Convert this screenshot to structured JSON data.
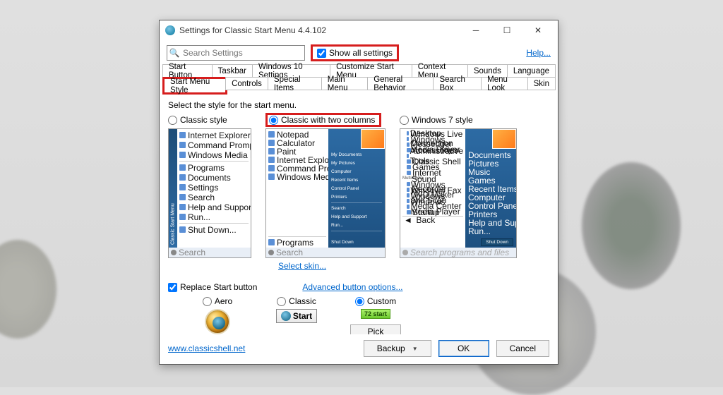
{
  "window": {
    "title": "Settings for Classic Start Menu 4.4.102"
  },
  "toolbar": {
    "search_placeholder": "Search Settings",
    "show_all_label": "Show all settings",
    "show_all_checked": true,
    "help_label": "Help..."
  },
  "tabs_row1": [
    "Start Button",
    "Taskbar",
    "Windows 10 Settings",
    "Customize Start Menu",
    "Context Menu",
    "Sounds",
    "Language"
  ],
  "tabs_row2_active": "Start Menu Style",
  "tabs_row2_rest": [
    "Controls",
    "Special Items",
    "Main Menu",
    "General Behavior",
    "Search Box",
    "Menu Look",
    "Skin"
  ],
  "content": {
    "description": "Select the style for the start menu.",
    "styles": {
      "classic": "Classic style",
      "twocol": "Classic with two columns",
      "win7": "Windows 7 style",
      "selected": "twocol"
    },
    "classic_side_label": "Classic Start Menu",
    "classic_items": [
      "Internet Explorer",
      "Command Prompt",
      "Windows Media Player"
    ],
    "classic_items2": [
      "Programs",
      "Documents",
      "Settings",
      "Search",
      "Help and Support",
      "Run..."
    ],
    "classic_items3": [
      "Shut Down..."
    ],
    "classic_search": "Search",
    "twocol_left": [
      "Notepad",
      "Calculator",
      "Paint",
      "Internet Explorer",
      "Command Prompt",
      "Windows Media Player"
    ],
    "twocol_left_bottom": "Programs",
    "twocol_right": [
      "My Documents",
      "My Pictures",
      "Computer",
      "Recent Items",
      "Control Panel",
      "Printers"
    ],
    "twocol_right2": [
      "Search",
      "Help and Support",
      "Run..."
    ],
    "twocol_right_shut": "Shut Down",
    "win7_left_header": "Remote Desktop Connection",
    "win7_left_items1": [
      "Windows Live Messenger",
      "Windows Media Player",
      "Accessories",
      "Administrative Tools",
      "Classic Shell",
      "Games",
      "Internet"
    ],
    "win7_left_group": "Multimedia",
    "win7_left_items2": [
      "Sound Recorder",
      "Windows DVD Maker",
      "Windows Fax and Scan",
      "Windows Media Center",
      "Windows Media Player",
      "Startup"
    ],
    "win7_left_back": "Back",
    "win7_search_hint": "Search programs and files",
    "win7_right": [
      "Documents",
      "Pictures",
      "Music",
      "Games",
      "Recent Items",
      "Computer",
      "Control Panel",
      "Printers",
      "Help and Support",
      "Run..."
    ],
    "win7_shut": "Shut Down",
    "select_skin": "Select skin...",
    "replace_label": "Replace Start button",
    "replace_checked": true,
    "advanced_link": "Advanced button options...",
    "button_styles": {
      "aero": "Aero",
      "classic": "Classic",
      "classic_btn_text": "Start",
      "custom": "Custom",
      "custom_preview": "72 start",
      "selected": "custom",
      "pick_label": "Pick image..."
    }
  },
  "footer": {
    "site_link": "www.classicshell.net",
    "backup": "Backup",
    "ok": "OK",
    "cancel": "Cancel"
  }
}
